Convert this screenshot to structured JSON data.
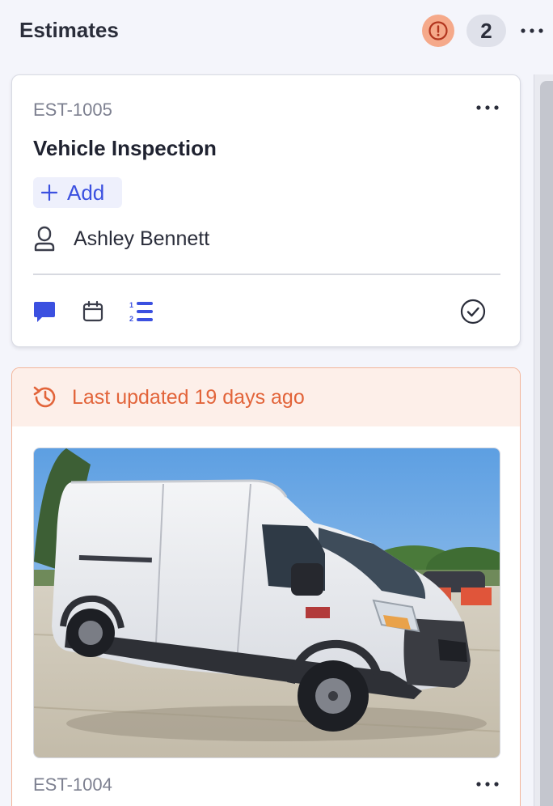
{
  "column": {
    "title": "Estimates",
    "count": "2",
    "alert_icon": "exclamation-circle-icon",
    "more_icon": "horizontal-dots-icon"
  },
  "cards": [
    {
      "id": "EST-1005",
      "title": "Vehicle Inspection",
      "add_label": "Add",
      "assignee": "Ashley Bennett",
      "icons": [
        "comment-icon",
        "calendar-icon",
        "ordered-list-icon",
        "check-circle-icon"
      ]
    },
    {
      "id": "EST-1004",
      "stale_notice": "Last updated 19 days ago",
      "image_subject": "white cargo van"
    }
  ],
  "colors": {
    "accent": "#3b50e0",
    "warning": "#e2643a",
    "warning_bg": "#fdefe9",
    "alert_badge": "#f5a98a",
    "count_badge": "#dfe1ea"
  }
}
